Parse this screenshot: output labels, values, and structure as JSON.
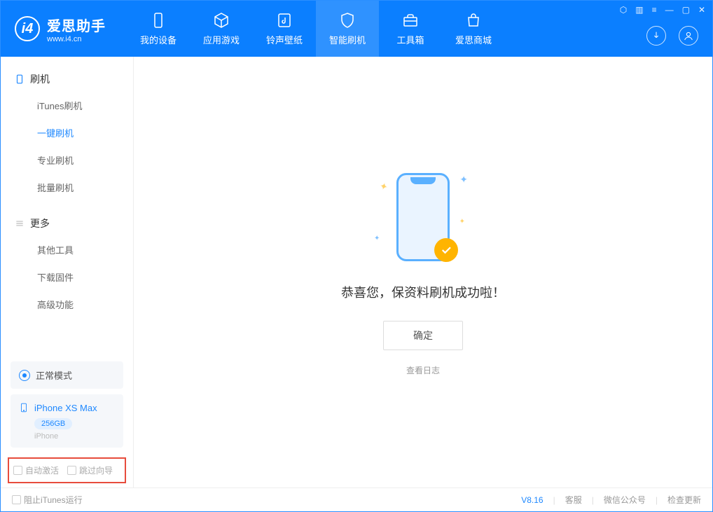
{
  "app": {
    "title": "爱思助手",
    "url": "www.i4.cn",
    "version": "V8.16"
  },
  "tabs": [
    {
      "label": "我的设备"
    },
    {
      "label": "应用游戏"
    },
    {
      "label": "铃声壁纸"
    },
    {
      "label": "智能刷机"
    },
    {
      "label": "工具箱"
    },
    {
      "label": "爱思商城"
    }
  ],
  "sidebar": {
    "section1": {
      "title": "刷机",
      "items": [
        "iTunes刷机",
        "一键刷机",
        "专业刷机",
        "批量刷机"
      ]
    },
    "section2": {
      "title": "更多",
      "items": [
        "其他工具",
        "下载固件",
        "高级功能"
      ]
    }
  },
  "status": {
    "mode": "正常模式"
  },
  "device": {
    "name": "iPhone XS Max",
    "storage": "256GB",
    "type": "iPhone"
  },
  "options": {
    "auto_activate": "自动激活",
    "skip_guide": "跳过向导"
  },
  "main": {
    "success": "恭喜您，保资料刷机成功啦！",
    "ok": "确定",
    "view_log": "查看日志"
  },
  "footer": {
    "block_itunes": "阻止iTunes运行",
    "service": "客服",
    "wechat": "微信公众号",
    "update": "检查更新"
  }
}
